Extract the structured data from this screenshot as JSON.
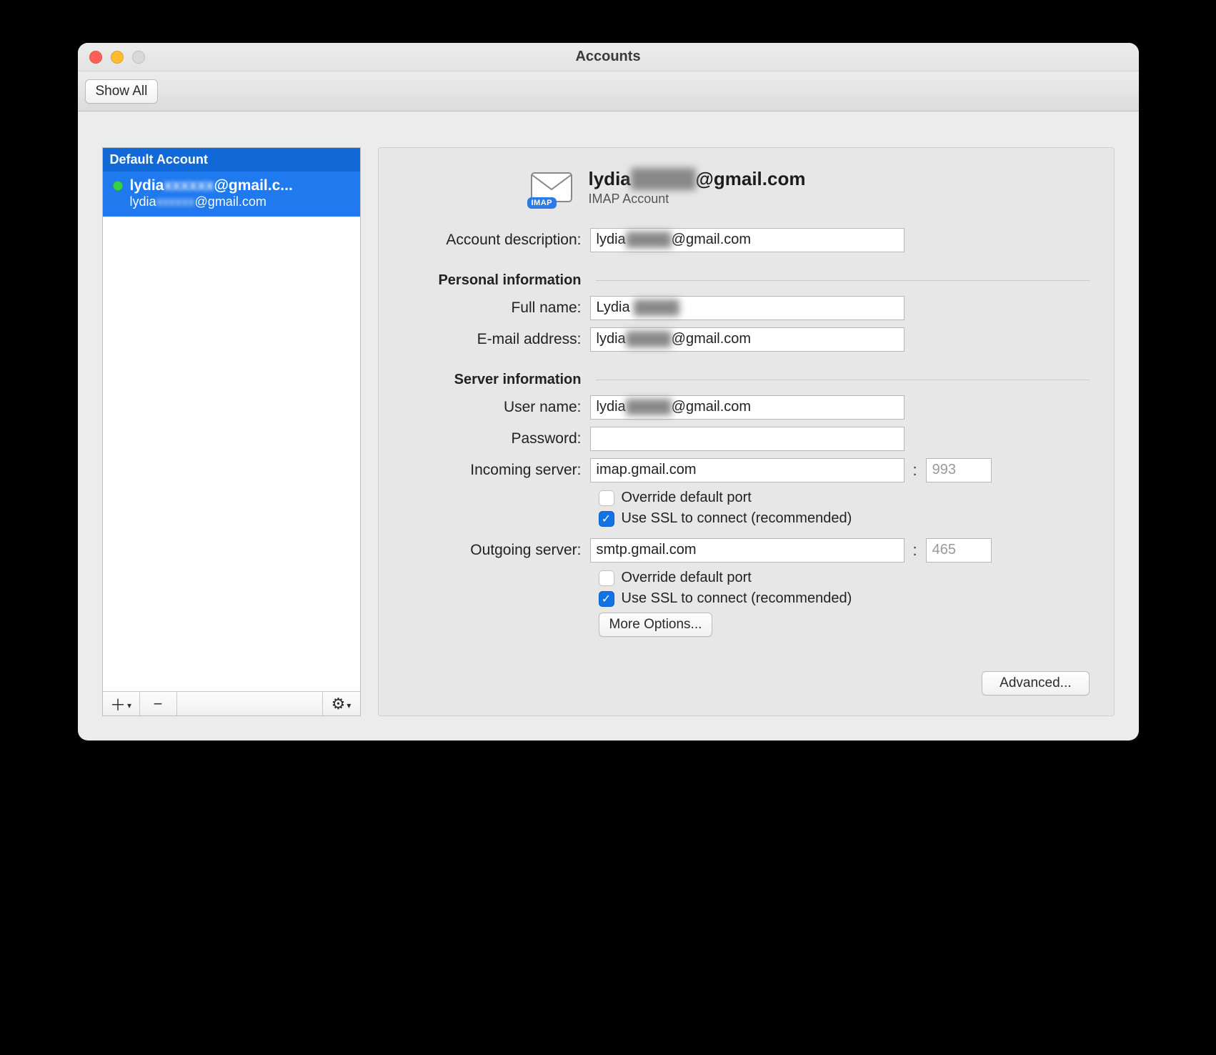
{
  "window": {
    "title": "Accounts"
  },
  "toolbar": {
    "show_all": "Show All"
  },
  "sidebar": {
    "group_label": "Default Account",
    "account": {
      "display_name": "lydia▇▇▇@gmail.c...",
      "subtitle_prefix": "lydia",
      "subtitle_suffix": "@gmail.com",
      "redacted_token": "xxxxxx"
    }
  },
  "header": {
    "title_prefix": "lydia",
    "title_suffix": "@gmail.com",
    "subtitle": "IMAP Account",
    "badge": "IMAP"
  },
  "labels": {
    "account_description": "Account description:",
    "personal_info": "Personal information",
    "full_name": "Full name:",
    "email": "E-mail address:",
    "server_info": "Server information",
    "user_name": "User name:",
    "password": "Password:",
    "incoming": "Incoming server:",
    "outgoing": "Outgoing server:",
    "override_port": "Override default port",
    "use_ssl": "Use SSL to connect (recommended)",
    "more_options": "More Options...",
    "advanced": "Advanced..."
  },
  "values": {
    "account_description_prefix": "lydia",
    "account_description_suffix": "@gmail.com",
    "full_name_prefix": "Lydia ",
    "email_prefix": "lydia",
    "email_suffix": "@gmail.com",
    "user_name_prefix": "lydia",
    "user_name_suffix": "@gmail.com",
    "password": "",
    "incoming_server": "imap.gmail.com",
    "incoming_port": "993",
    "outgoing_server": "smtp.gmail.com",
    "outgoing_port": "465",
    "incoming_override": false,
    "incoming_ssl": true,
    "outgoing_override": false,
    "outgoing_ssl": true
  },
  "redacted": "xxxxxx"
}
